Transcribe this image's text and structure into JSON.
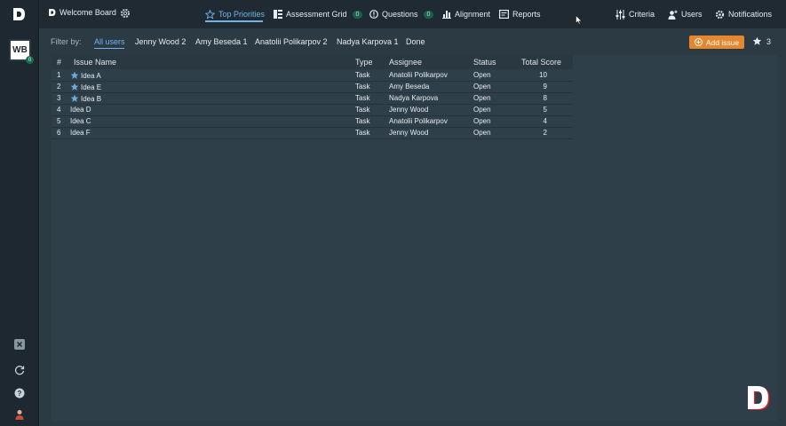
{
  "board": {
    "title": "Welcome Board",
    "short": "WB",
    "badge": "0"
  },
  "nav": [
    {
      "label": "Top Priorities",
      "active": true,
      "icon": "star-outline-icon"
    },
    {
      "label": "Assessment Grid",
      "count": "0",
      "icon": "grid-icon"
    },
    {
      "label": "Questions",
      "count": "0",
      "icon": "question-circle-icon"
    },
    {
      "label": "Alignment",
      "icon": "bar-chart-icon"
    },
    {
      "label": "Reports",
      "icon": "report-icon"
    }
  ],
  "right_nav": {
    "criteria": "Criteria",
    "users": "Users",
    "notifications": "Notifications"
  },
  "filter": {
    "label": "Filter by:",
    "options": [
      {
        "label": "All users",
        "active": true
      },
      {
        "label": "Jenny Wood 2"
      },
      {
        "label": "Amy Beseda 1"
      },
      {
        "label": "Anatolii Polikarpov 2"
      },
      {
        "label": "Nadya Karpova 1"
      },
      {
        "label": "Done"
      }
    ]
  },
  "actions": {
    "add_issue": "Add issue",
    "star_count": "3"
  },
  "table": {
    "headers": {
      "num": "#",
      "name": "Issue Name",
      "type": "Type",
      "assignee": "Assignee",
      "status": "Status",
      "score": "Total Score"
    },
    "rows": [
      {
        "num": "1",
        "name": "Idea A",
        "starred": true,
        "type": "Task",
        "assignee": "Anatolii Polikarpov",
        "status": "Open",
        "score": "10"
      },
      {
        "num": "2",
        "name": "Idea E",
        "starred": true,
        "type": "Task",
        "assignee": "Amy Beseda",
        "status": "Open",
        "score": "9"
      },
      {
        "num": "3",
        "name": "Idea B",
        "starred": true,
        "type": "Task",
        "assignee": "Nadya Karpova",
        "status": "Open",
        "score": "8"
      },
      {
        "num": "4",
        "name": "Idea D",
        "starred": false,
        "type": "Task",
        "assignee": "Jenny Wood",
        "status": "Open",
        "score": "5"
      },
      {
        "num": "5",
        "name": "Idea C",
        "starred": false,
        "type": "Task",
        "assignee": "Anatolii Polikarpov",
        "status": "Open",
        "score": "4"
      },
      {
        "num": "6",
        "name": "Idea F",
        "starred": false,
        "type": "Task",
        "assignee": "Jenny Wood",
        "status": "Open",
        "score": "2"
      }
    ]
  },
  "colors": {
    "accent": "#6fb5ea",
    "add_button": "#e4872e",
    "brand_red": "#d32027",
    "background": "#2c3a44"
  }
}
